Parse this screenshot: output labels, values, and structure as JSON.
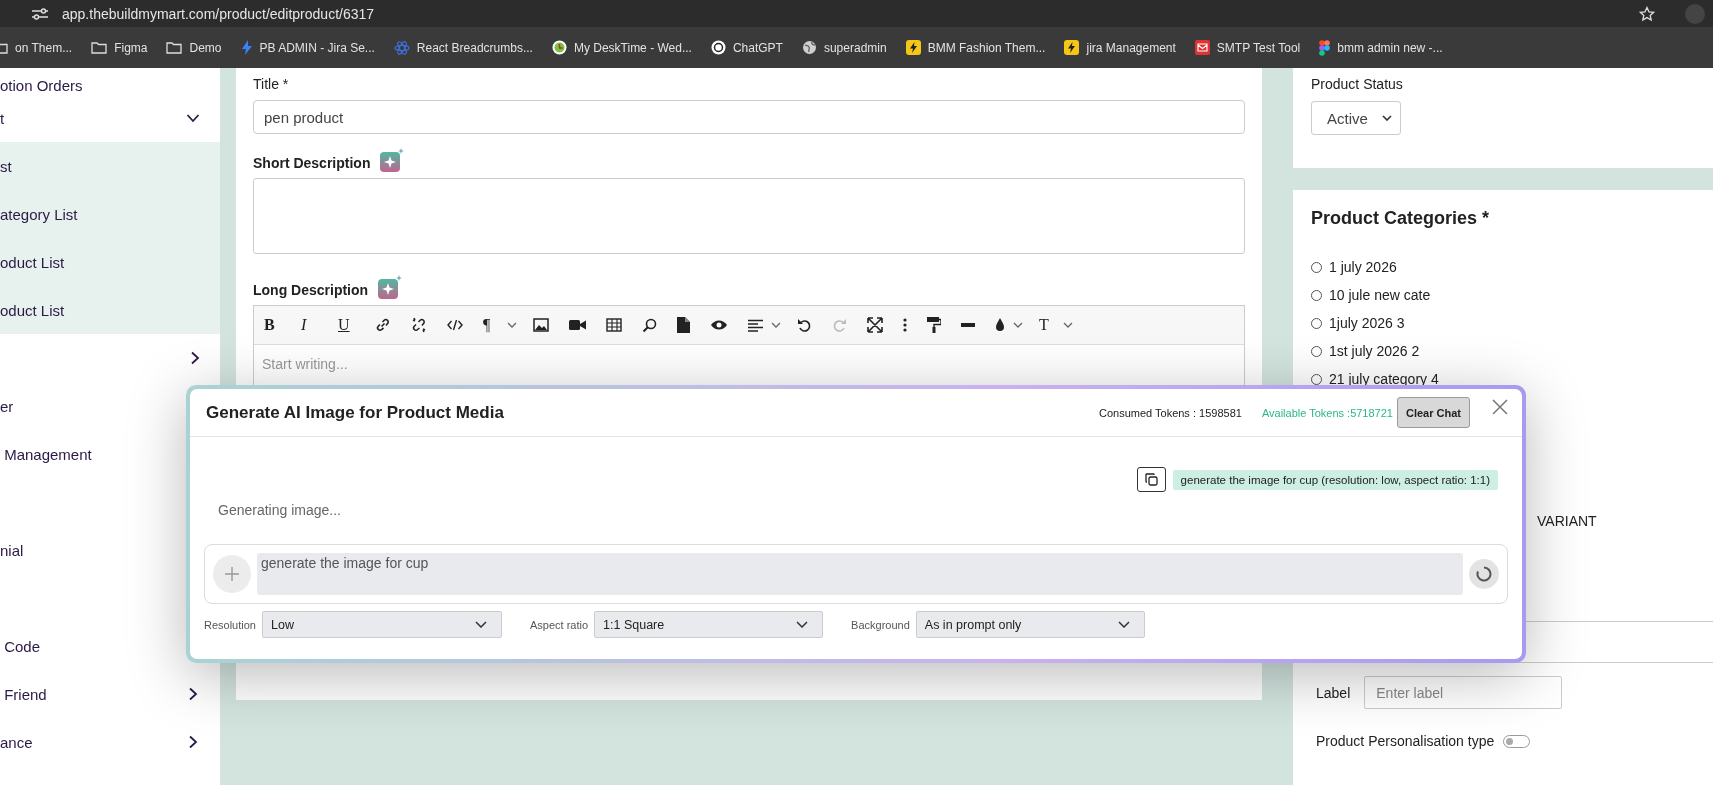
{
  "browser": {
    "url": "app.thebuildmymart.com/product/editproduct/6317",
    "bookmarks": [
      {
        "kind": "folder-cut",
        "label": "on Them..."
      },
      {
        "kind": "folder",
        "label": "Figma"
      },
      {
        "kind": "folder",
        "label": "Demo"
      },
      {
        "kind": "bolt-blue",
        "label": "PB ADMIN  - Jira Se..."
      },
      {
        "kind": "react",
        "label": "React Breadcrumbs..."
      },
      {
        "kind": "desktime",
        "label": "My DeskTime - Wed..."
      },
      {
        "kind": "chatgpt",
        "label": "ChatGPT"
      },
      {
        "kind": "globe",
        "label": "superadmin"
      },
      {
        "kind": "bolt-yellow",
        "label": "BMM Fashion Them..."
      },
      {
        "kind": "bolt-yellow",
        "label": "jira Management"
      },
      {
        "kind": "smtp",
        "label": "SMTP Test Tool"
      },
      {
        "kind": "figma",
        "label": "bmm admin new -..."
      }
    ]
  },
  "sidebar": {
    "items": [
      {
        "kind": "item",
        "label": "otion Orders"
      },
      {
        "kind": "item",
        "label": "t",
        "expanded": true,
        "children": [
          {
            "label": "st"
          },
          {
            "label": "ategory List"
          },
          {
            "label": "oduct List"
          },
          {
            "label": "oduct List"
          }
        ]
      },
      {
        "kind": "chevron-only",
        "expanded": false
      },
      {
        "kind": "item",
        "label": "er"
      },
      {
        "kind": "item",
        "label": " Management"
      },
      {
        "kind": "blank"
      },
      {
        "kind": "item",
        "label": "nial"
      },
      {
        "kind": "blank"
      },
      {
        "kind": "item",
        "label": " Code"
      },
      {
        "kind": "item",
        "label": " Friend",
        "expanded": false
      },
      {
        "kind": "item",
        "label": "ance",
        "expanded": false
      }
    ]
  },
  "form": {
    "title_label": "Title *",
    "title_value": "pen product",
    "short_description_label": "Short Description",
    "long_description_label": "Long Description",
    "editor": {
      "letters": [
        "B",
        "I",
        "U",
        "¶",
        "T"
      ],
      "redo_disabled": true,
      "placeholder": "Start writing..."
    }
  },
  "status_card": {
    "label": "Product Status",
    "value": "Active"
  },
  "categories": {
    "title": "Product Categories *",
    "items": [
      {
        "label": "1 july 2026",
        "selected": false
      },
      {
        "label": "10 jule new cate",
        "selected": false
      },
      {
        "label": "1july 2026 3",
        "selected": false
      },
      {
        "label": "1st july 2026 2",
        "selected": false
      },
      {
        "label": "21 july category 4",
        "selected": false
      }
    ],
    "variant_label": "VARIANT",
    "label_field": {
      "label": "Label",
      "placeholder": "Enter label"
    },
    "personalisation": {
      "label": "Product Personalisation type",
      "on": false
    }
  },
  "modal": {
    "title": "Generate AI Image for Product Media",
    "consumed": "Consumed Tokens : 1598581",
    "available": "Available Tokens :5718721",
    "clear_button": "Clear Chat",
    "user_message": "generate the image for cup (resolution: low, aspect ratio: 1:1)",
    "status": "Generating image...",
    "prompt_value": "generate the image for cup",
    "options": [
      {
        "label": "Resolution",
        "value": "Low"
      },
      {
        "label": "Aspect ratio",
        "value": "1:1 Square"
      },
      {
        "label": "Background",
        "value": "As in prompt only"
      }
    ]
  }
}
